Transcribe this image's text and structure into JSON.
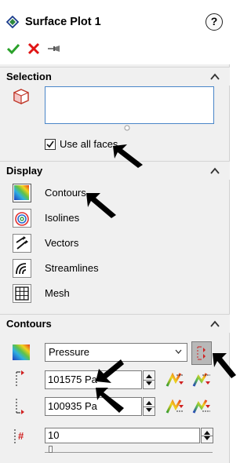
{
  "header": {
    "title": "Surface Plot 1",
    "help": "?"
  },
  "sections": {
    "selection": "Selection",
    "display": "Display",
    "contours": "Contours"
  },
  "selection": {
    "use_all_faces_label": "Use all faces",
    "use_all_faces_checked": true
  },
  "display": {
    "items": [
      {
        "label": "Contours",
        "icon": "contours-icon"
      },
      {
        "label": "Isolines",
        "icon": "isolines-icon"
      },
      {
        "label": "Vectors",
        "icon": "vectors-icon"
      },
      {
        "label": "Streamlines",
        "icon": "streamlines-icon"
      },
      {
        "label": "Mesh",
        "icon": "mesh-icon"
      }
    ]
  },
  "contours": {
    "parameter": "Pressure",
    "max_value": "101575 Pa",
    "min_value": "100935 Pa",
    "levels": "10"
  }
}
